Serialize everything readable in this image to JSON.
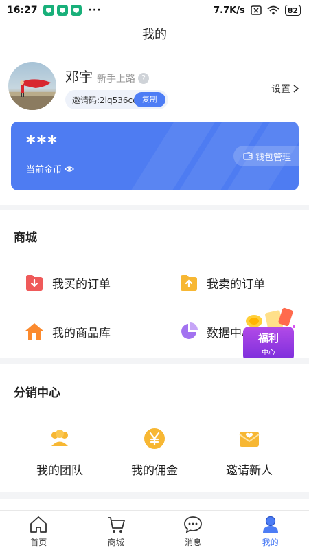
{
  "status_bar": {
    "time": "16:27",
    "network_speed": "7.7K/s",
    "battery": "82",
    "more": "···"
  },
  "header": {
    "title": "我的"
  },
  "profile": {
    "name": "邓宇",
    "level": "新手上路",
    "help": "?",
    "invite_code": "邀请码:2iq536ce",
    "copy_label": "复制",
    "settings_label": "设置"
  },
  "wallet": {
    "balance_masked": "***",
    "balance_label": "当前金币",
    "manage_label": "钱包管理",
    "card_color": "#4e7cf2"
  },
  "mall": {
    "title": "商城",
    "items": [
      {
        "label": "我买的订单",
        "icon": "download-folder-icon"
      },
      {
        "label": "我卖的订单",
        "icon": "upload-folder-icon"
      },
      {
        "label": "我的商品库",
        "icon": "home-icon"
      },
      {
        "label": "数据中心",
        "icon": "pie-chart-icon"
      }
    ]
  },
  "welfare": {
    "main": "福利",
    "sub": "中心"
  },
  "distribution": {
    "title": "分销中心",
    "items": [
      {
        "label": "我的团队",
        "icon": "team-icon"
      },
      {
        "label": "我的佣金",
        "icon": "yen-coin-icon"
      },
      {
        "label": "邀请新人",
        "icon": "invite-envelope-icon"
      }
    ]
  },
  "bottom_nav": {
    "items": [
      {
        "label": "首页",
        "icon": "home-icon"
      },
      {
        "label": "商城",
        "icon": "cart-icon"
      },
      {
        "label": "消息",
        "icon": "message-icon"
      },
      {
        "label": "我的",
        "icon": "user-icon",
        "active": true
      }
    ],
    "active_color": "#4d7df5"
  }
}
